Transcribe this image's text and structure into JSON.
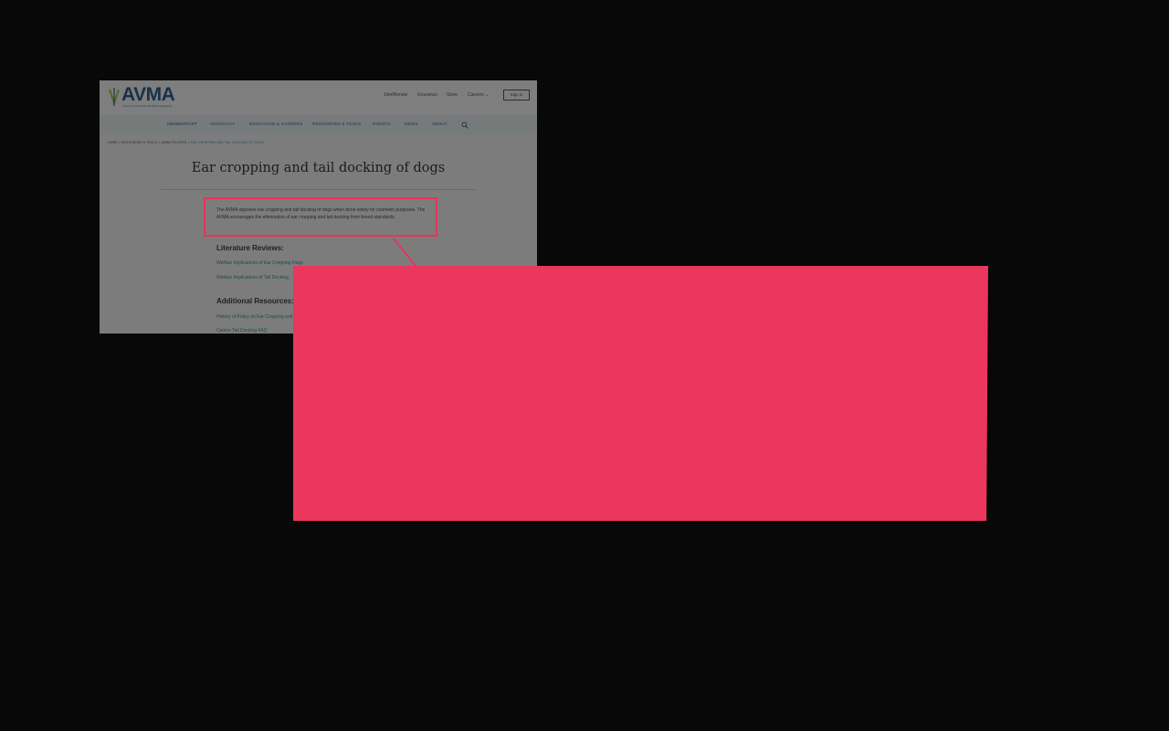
{
  "site": {
    "logo": "AVMA",
    "logo_sub": "American Veterinary Medical Association",
    "utility_links": [
      "Join/Renew",
      "Insurance",
      "Store",
      "Careers"
    ],
    "careers_chevron": "chevron-down-icon",
    "signin_label": "Sign in"
  },
  "nav": {
    "items": [
      "MEMBERSHIP",
      "ADVOCACY",
      "EDUCATION & CAREERS",
      "RESOURCES & TOOLS",
      "EVENTS",
      "NEWS",
      "ABOUT"
    ],
    "search_icon": "search-icon"
  },
  "breadcrumb": {
    "items": [
      "HOME",
      "RESOURCES & TOOLS",
      "AVMA POLICIES"
    ],
    "current": "EAR CROPPING AND TAIL DOCKING OF DOGS",
    "separator": ">"
  },
  "page": {
    "title": "Ear cropping and tail docking of dogs",
    "policy_text": "The AVMA opposes ear cropping and tail docking of dogs when done solely for cosmetic purposes. The AVMA encourages the elimination of ear cropping and tail docking from breed standards.",
    "literature_heading": "Literature Reviews:",
    "literature_links": [
      "Welfare Implications of Ear Cropping-Dogs",
      "Welfare Implications of Tail Docking"
    ],
    "additional_heading": "Additional Resources:",
    "additional_links": [
      "History of Policy on Ear Cropping and",
      "Canine Tail Docking FAQ"
    ]
  },
  "colors": {
    "background": "#080808",
    "highlight": "#e8335d",
    "callout": "#eb365d"
  }
}
